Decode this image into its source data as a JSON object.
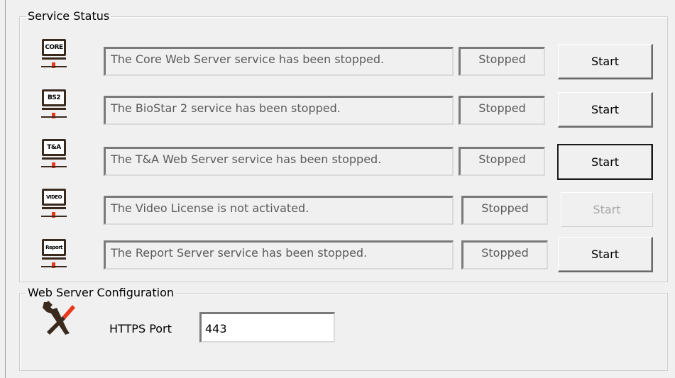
{
  "service_status": {
    "title": "Service Status",
    "services": [
      {
        "icon_label": "CORE",
        "icon": "core-server-icon",
        "message": "The Core Web Server service has been stopped.",
        "status": "Stopped",
        "button_label": "Start",
        "button_state": "normal"
      },
      {
        "icon_label": "BS2",
        "icon": "biostar2-server-icon",
        "message": "The BioStar 2 service has been stopped.",
        "status": "Stopped",
        "button_label": "Start",
        "button_state": "normal"
      },
      {
        "icon_label": "T&A",
        "icon": "ta-server-icon",
        "message": "The T&A Web Server service has been stopped.",
        "status": "Stopped",
        "button_label": "Start",
        "button_state": "focused"
      },
      {
        "icon_label": "VIDEO",
        "icon": "video-server-icon",
        "message": "The Video License is not activated.",
        "status": "Stopped",
        "button_label": "Start",
        "button_state": "disabled"
      },
      {
        "icon_label": "Report",
        "icon": "report-server-icon",
        "message": "The Report Server service has been stopped.",
        "status": "Stopped",
        "button_label": "Start",
        "button_state": "normal"
      }
    ]
  },
  "web_server_config": {
    "title": "Web Server Configuration",
    "icon": "tools-icon",
    "https_port_label": "HTTPS Port",
    "https_port_value": "443"
  },
  "colors": {
    "window_bg": "#f0f0f0",
    "icon_dark": "#3a2a1e",
    "icon_accent": "#e8391c",
    "disabled_text": "#a8a8a8"
  }
}
